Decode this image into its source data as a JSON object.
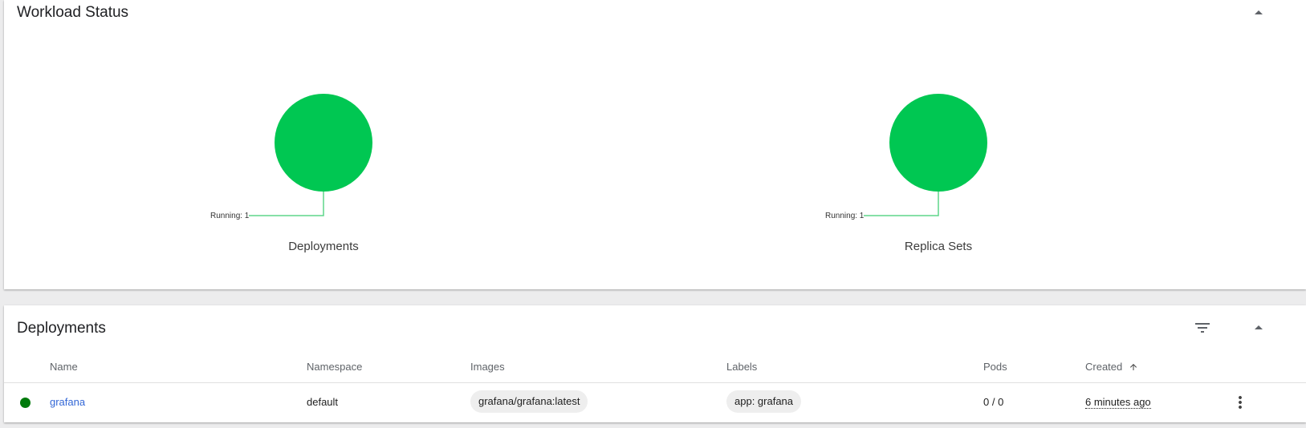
{
  "workload_status": {
    "title": "Workload Status",
    "charts": [
      {
        "caption": "Deployments",
        "running_label": "Running: 1",
        "color": "#00c752"
      },
      {
        "caption": "Replica Sets",
        "running_label": "Running: 1",
        "color": "#00c752"
      }
    ]
  },
  "deployments": {
    "title": "Deployments",
    "columns": {
      "name": "Name",
      "namespace": "Namespace",
      "images": "Images",
      "labels": "Labels",
      "pods": "Pods",
      "created": "Created"
    },
    "rows": [
      {
        "status": "running",
        "name": "grafana",
        "namespace": "default",
        "image": "grafana/grafana:latest",
        "label": "app: grafana",
        "pods": "0 / 0",
        "created": "6 minutes ago"
      }
    ]
  },
  "colors": {
    "running": "#00c752",
    "status_dot": "#007a0c",
    "link": "#3367d6"
  },
  "icons": {
    "collapse": "chevron-up-icon",
    "filter": "filter-list-icon",
    "sort": "arrow-upward-icon",
    "row_menu": "more-vert-icon"
  }
}
